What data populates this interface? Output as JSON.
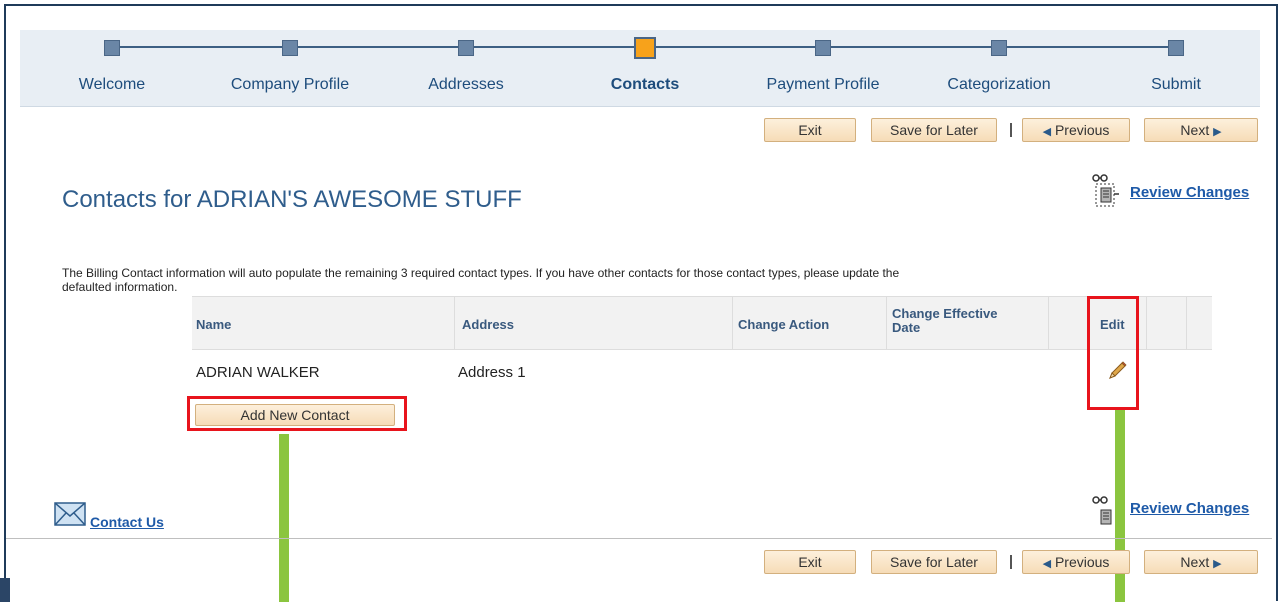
{
  "steps": [
    {
      "label": "Welcome"
    },
    {
      "label": "Company Profile"
    },
    {
      "label": "Addresses"
    },
    {
      "label": "Contacts",
      "active": true
    },
    {
      "label": "Payment Profile"
    },
    {
      "label": "Categorization"
    },
    {
      "label": "Submit"
    }
  ],
  "nav": {
    "exit": "Exit",
    "save_later": "Save for Later",
    "previous": "Previous",
    "next": "Next"
  },
  "page": {
    "title": "Contacts for ADRIAN'S AWESOME STUFF",
    "review_changes": "Review Changes",
    "info": "The Billing Contact information will auto populate the remaining 3 required contact types. If you have other contacts for those contact types, please update the defaulted information."
  },
  "grid": {
    "headers": {
      "name": "Name",
      "address": "Address",
      "change_action": "Change Action",
      "change_effective_date": "Change Effective Date",
      "edit": "Edit"
    },
    "rows": [
      {
        "name": "ADRIAN WALKER",
        "address": "Address 1",
        "change_action": "",
        "change_effective_date": ""
      }
    ]
  },
  "add_contact": "Add New Contact",
  "footer": {
    "contact_us": "Contact Us"
  },
  "icons": {
    "review": "review-changes-icon",
    "edit": "pencil-icon",
    "contact": "envelope-icon"
  },
  "colors": {
    "highlight_box": "#e8141c",
    "annotation_bar": "#8bc53f",
    "active_step": "#f7a21b"
  }
}
